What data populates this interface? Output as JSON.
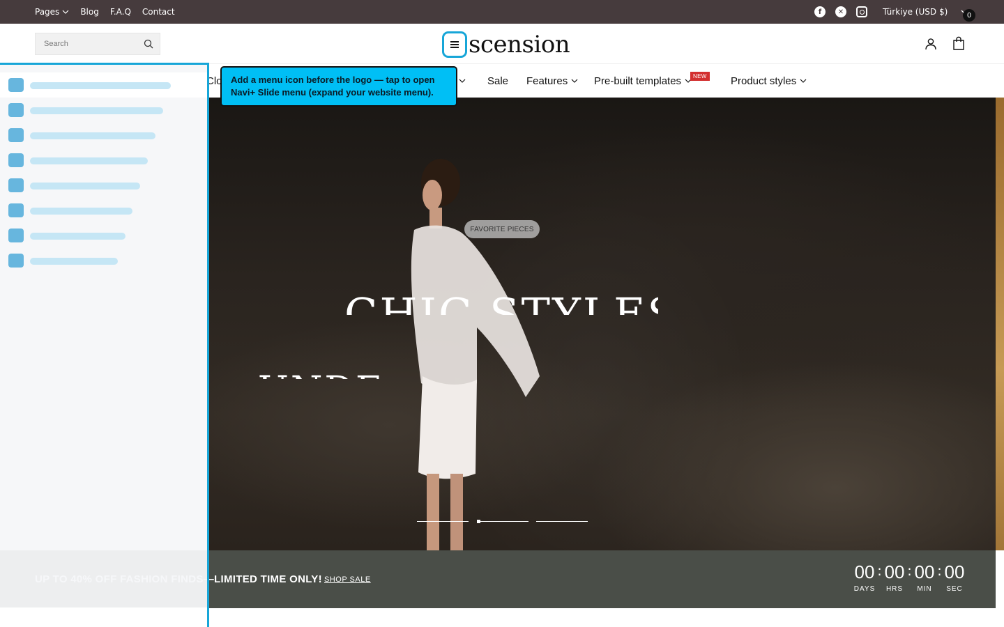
{
  "topbar": {
    "nav": [
      {
        "label": "Pages",
        "has_dropdown": true
      },
      {
        "label": "Blog"
      },
      {
        "label": "F.A.Q"
      },
      {
        "label": "Contact"
      }
    ],
    "social": [
      "facebook-icon",
      "x-icon",
      "instagram-icon"
    ],
    "currency": "Türkiye (USD $)",
    "bg_color": "#463b3d"
  },
  "header": {
    "search_placeholder": "Search",
    "logo_text": "scension",
    "cart_count": "0",
    "highlight_color": "#17a6d8"
  },
  "mainnav": {
    "partial_first": "Clot",
    "items": [
      {
        "label": "Sale"
      },
      {
        "label": "Features",
        "has_dropdown": true
      },
      {
        "label": "Pre-built templates",
        "has_dropdown": true,
        "badge": "NEW"
      },
      {
        "label": "Product styles",
        "has_dropdown": true
      }
    ]
  },
  "tooltip": {
    "text": "Add a menu icon before the logo — tap to open Navi+ Slide menu (expand your website menu)."
  },
  "hero": {
    "pill": "FAVORITE PIECES",
    "headline": "CHIC STYLES",
    "subline": "UNDE",
    "slides": 3,
    "active_slide_progress": 0.0
  },
  "promo": {
    "message": "UP TO 40% OFF FASHION FINDS—LIMITED TIME ONLY!",
    "shop_label": "SHOP SALE",
    "bg_color": "#4a4e48",
    "countdown": [
      {
        "value": "00",
        "label": "DAYS"
      },
      {
        "value": "00",
        "label": "HRS"
      },
      {
        "value": "00",
        "label": "MIN"
      },
      {
        "value": "00",
        "label": "SEC"
      }
    ]
  },
  "slide_menu": {
    "item_count": 8,
    "accent_color": "#67b6de"
  }
}
